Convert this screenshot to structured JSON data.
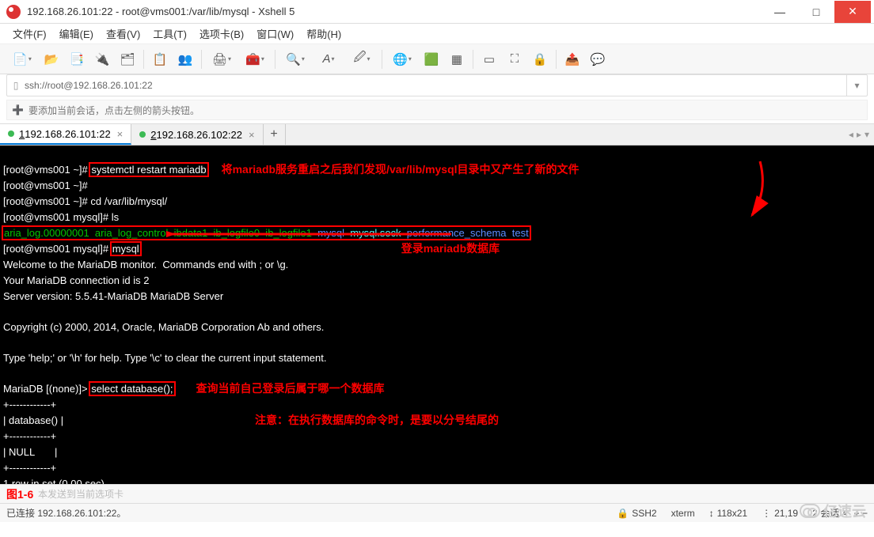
{
  "window": {
    "title": "192.168.26.101:22 - root@vms001:/var/lib/mysql - Xshell 5",
    "min": "—",
    "max": "□",
    "close": "✕"
  },
  "menu": {
    "file": "文件(F)",
    "edit": "编辑(E)",
    "view": "查看(V)",
    "tools": "工具(T)",
    "tab": "选项卡(B)",
    "window": "窗口(W)",
    "help": "帮助(H)"
  },
  "address": {
    "url": "ssh://root@192.168.26.101:22"
  },
  "hint": {
    "text": "要添加当前会话，点击左侧的箭头按钮。"
  },
  "tabs": {
    "t1_num": "1",
    "t1_label": " 192.168.26.101:22",
    "t2_num": "2",
    "t2_label": " 192.168.26.102:22",
    "add": "+"
  },
  "term": {
    "l1a": "[root@vms001 ~]# ",
    "l1b": "systemctl restart mariadb",
    "ann1": "将mariadb服务重启之后我们发现/var/lib/mysql目录中又产生了新的文件",
    "l2": "[root@vms001 ~]#",
    "l3": "[root@vms001 ~]# cd /var/lib/mysql/",
    "l4": "[root@vms001 mysql]# ls",
    "l5a": "aria_log.00000001  aria_log_control  ibdata1  ib_logfile0  ib_logfile1  ",
    "l5b": "mysql",
    "l5c": "mysql.sock",
    "l5d": "performance_schema",
    "l5e": "test",
    "l6a": "[root@vms001 mysql]# ",
    "l6b": "mysql",
    "ann2": "登录mariadb数据库",
    "l7": "Welcome to the MariaDB monitor.  Commands end with ; or \\g.",
    "l8": "Your MariaDB connection id is 2",
    "l9": "Server version: 5.5.41-MariaDB MariaDB Server",
    "l10": "Copyright (c) 2000, 2014, Oracle, MariaDB Corporation Ab and others.",
    "l11": "Type 'help;' or '\\h' for help. Type '\\c' to clear the current input statement.",
    "l12a": "MariaDB [(none)]> ",
    "l12b": "select database();",
    "ann3": "查询当前自己登录后属于哪一个数据库",
    "ann4": "注意：在执行数据库的命令时，是要以分号结尾的",
    "l13": "+------------+",
    "l14": "| database() |",
    "l15": "+------------+",
    "l16": "| NULL       |",
    "l17": "+------------+",
    "l18": "1 row in set (0.00 sec)"
  },
  "sendhint": {
    "fig": "图1-6",
    "text": "本发送到当前选项卡"
  },
  "status": {
    "left": "已连接 192.168.26.101:22。",
    "proto": "SSH2",
    "termtype": "xterm",
    "size": "118x21",
    "pos": "21,19",
    "sessions": "2 会话"
  },
  "watermark": {
    "text": "亿速云"
  }
}
